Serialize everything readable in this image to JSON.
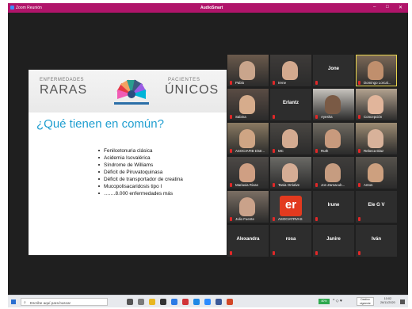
{
  "window": {
    "app_title": "Zoom Reunión",
    "center_label": "AudioSmart",
    "minimize_glyph": "–",
    "maximize_glyph": "□",
    "close_glyph": "✕"
  },
  "slide": {
    "logo_top_left": "ENFERMEDADES",
    "logo_big_left": "RARAS",
    "logo_top_right": "PACIENTES",
    "logo_big_right": "ÚNICOS",
    "question": "¿Qué tienen en común?",
    "items": [
      "Fenilcetonuria clásica",
      "Acidemia Isovalérica",
      "Síndrome de Williams",
      "Déficit de Piruvatoquinasa",
      "Déficit de transportador de creatina",
      "Mucopolisacaridosis tipo I",
      "…….8.000 enfermedades más"
    ],
    "colors": {
      "question": "#1f9ed0"
    }
  },
  "participants": [
    {
      "label": "Pablo",
      "type": "video",
      "skin": "#c9a58c",
      "bg": "#6b5a4c"
    },
    {
      "label": "Irene",
      "type": "video",
      "skin": "#d2a98e",
      "bg": "#3e3b39"
    },
    {
      "label": "Jone",
      "type": "name"
    },
    {
      "label": "Domingo Lorcal...",
      "type": "video",
      "skin": "#c08f6d",
      "bg": "#7d6a58",
      "active": true
    },
    {
      "label": "Sabina",
      "type": "video",
      "skin": "#d6ac8c",
      "bg": "#5a4c44"
    },
    {
      "label": "Erlantz",
      "type": "name"
    },
    {
      "label": "Ayesha",
      "type": "video",
      "skin": "#7a5a45",
      "bg": "#c8c4be"
    },
    {
      "label": "Concepción",
      "type": "video",
      "skin": "#e1b59b",
      "bg": "#b3a28f"
    },
    {
      "label": "ASOCIAFIB Distr...",
      "type": "video",
      "skin": "#cfa584",
      "bg": "#8a7a62"
    },
    {
      "label": "MC",
      "type": "video",
      "skin": "#d4ab91",
      "bg": "#4a4743"
    },
    {
      "label": "Ruth",
      "type": "video",
      "skin": "#c89a7d",
      "bg": "#6f6a61"
    },
    {
      "label": "Rebeca Diaz",
      "type": "video",
      "skin": "#d8b29a",
      "bg": "#9c8b73"
    },
    {
      "label": "Mariaxia Rivas",
      "type": "video",
      "skin": "#cf9f83",
      "bg": "#4d4946"
    },
    {
      "label": "Tania Orrialve",
      "type": "video",
      "skin": "#d5ad95",
      "bg": "#6b6a66"
    },
    {
      "label": "Jon Zamacub...",
      "type": "video",
      "skin": "#c69c80",
      "bg": "#3f3d3b"
    },
    {
      "label": "Anton",
      "type": "video",
      "skin": "#cda07f",
      "bg": "#56524c"
    },
    {
      "label": "Julio Fuente",
      "type": "video",
      "skin": "#caa28a",
      "bg": "#7b6f64"
    },
    {
      "label": "ASOCIATRVAS",
      "type": "logo",
      "logo_text": "er"
    },
    {
      "label": "Irune",
      "type": "name"
    },
    {
      "label": "Ele G V",
      "type": "name"
    },
    {
      "label": "Alexandra",
      "type": "name"
    },
    {
      "label": "rosa",
      "type": "name"
    },
    {
      "label": "Janire",
      "type": "name"
    },
    {
      "label": "Iván",
      "type": "name"
    }
  ],
  "taskbar": {
    "search_placeholder": "Escribe aquí para buscar",
    "battery": "80%",
    "tray_button": "Destino siguiente",
    "time": "10:02",
    "date": "26/11/2020"
  }
}
